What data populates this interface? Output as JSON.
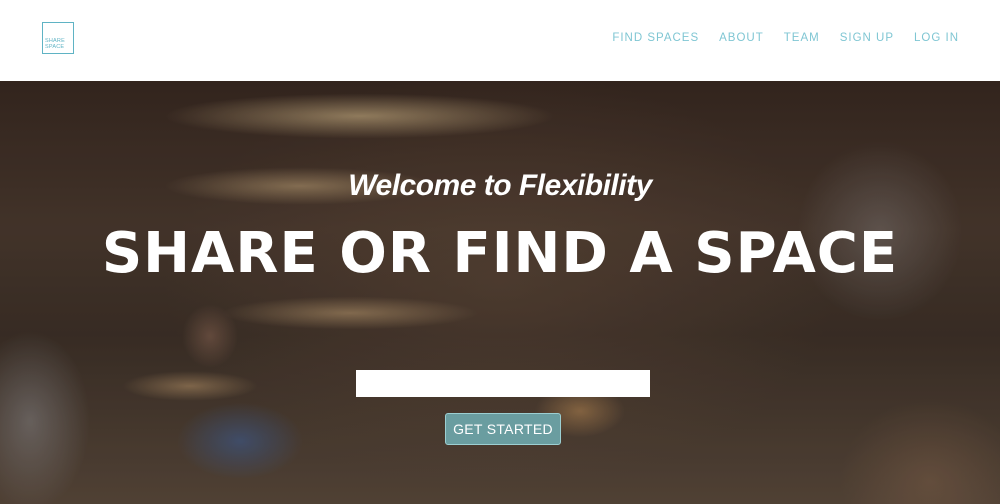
{
  "header": {
    "logo": {
      "line1": "SHARE",
      "line2": "SPACE"
    },
    "nav": [
      {
        "label": "FIND SPACES"
      },
      {
        "label": "ABOUT"
      },
      {
        "label": "TEAM"
      },
      {
        "label": "SIGN UP"
      },
      {
        "label": "LOG IN"
      }
    ]
  },
  "hero": {
    "tagline": "Welcome to Flexibility",
    "headline": "SHARE OR FIND A SPACE",
    "search_value": "",
    "cta_label": "GET STARTED"
  },
  "colors": {
    "brand": "#5fb3c4",
    "nav_text": "#7fc6d3",
    "cta_background": "#6a9da0",
    "hero_text": "#ffffff"
  }
}
